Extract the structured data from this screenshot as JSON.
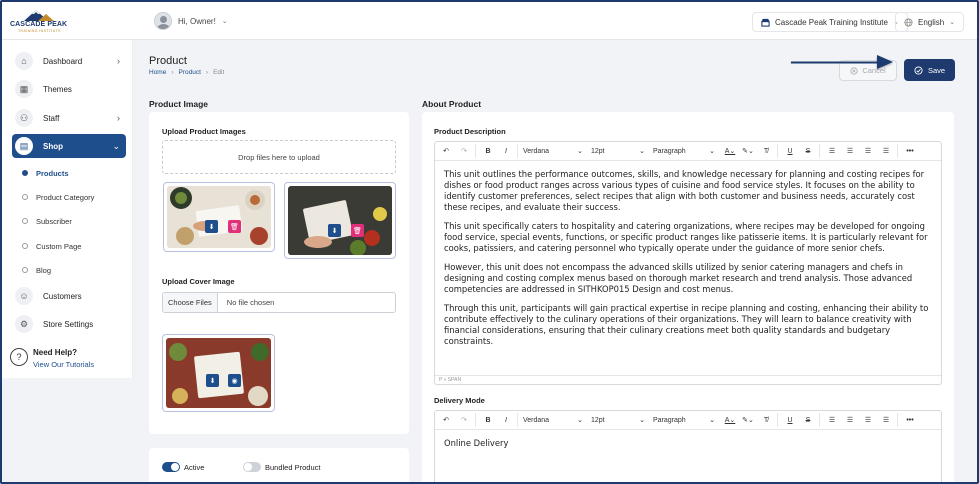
{
  "brand": {
    "name": "CASCADE PEAK",
    "tagline": "TRAINING INSTITUTE"
  },
  "header": {
    "greeting": "Hi, Owner!",
    "institute": "Cascade Peak Training Institute",
    "language": "English"
  },
  "sidebar": {
    "items": [
      {
        "label": "Dashboard",
        "icon": "home-icon"
      },
      {
        "label": "Themes",
        "icon": "themes-icon"
      },
      {
        "label": "Staff",
        "icon": "staff-icon"
      },
      {
        "label": "Shop",
        "icon": "shop-icon"
      },
      {
        "label": "Customers",
        "icon": "customer-icon"
      },
      {
        "label": "Store Settings",
        "icon": "gear-icon"
      }
    ],
    "shop_sub": [
      "Products",
      "Product Category",
      "Subscriber",
      "Custom Page",
      "Blog"
    ],
    "help_title": "Need Help?",
    "help_link": "View Our Tutorials"
  },
  "page": {
    "title": "Product",
    "breadcrumb": [
      "Home",
      "Product",
      "Edit"
    ],
    "cancel_label": "Cancel",
    "save_label": "Save"
  },
  "product_image": {
    "section_title": "Product Image",
    "upload_label": "Upload Product Images",
    "dropzone_text": "Drop files here to upload",
    "cover_label": "Upload Cover Image",
    "choose_files": "Choose Files",
    "no_file": "No file chosen"
  },
  "toggles": {
    "active_label": "Active",
    "bundled_label": "Bundled Product"
  },
  "about": {
    "section_title": "About Product",
    "description_label": "Product Description",
    "delivery_label": "Delivery Mode",
    "toolbar": {
      "font": "Verdana",
      "size": "12pt",
      "block": "Paragraph"
    },
    "status_path": "P » SPAN",
    "description_paragraphs": [
      "This unit outlines the performance outcomes, skills, and knowledge necessary for planning and costing recipes for dishes or food product ranges across various types of cuisine and food service styles. It focuses on the ability to identify customer preferences, select recipes that align with both customer and business needs, accurately cost these recipes, and evaluate their success.",
      "This unit specifically caters to hospitality and catering organizations, where recipes may be developed for ongoing food service, special events, functions, or specific product ranges like patisserie items. It is particularly relevant for cooks, patissiers, and catering personnel who typically operate under the guidance of more senior chefs.",
      "However, this unit does not encompass the advanced skills utilized by senior catering managers and chefs in designing and costing complex menus based on thorough market research and trend analysis. Those advanced competencies are addressed in SITHKOP015 Design and cost menus.",
      "Through this unit, participants will gain practical expertise in recipe planning and costing, enhancing their ability to contribute effectively to the culinary operations of their organizations. They will learn to balance creativity with financial considerations, ensuring that their culinary creations meet both quality standards and budgetary constraints."
    ],
    "delivery_text": "Online Delivery"
  },
  "colors": {
    "primary": "#1f3a6e",
    "accent": "#1f4e8c",
    "pink": "#e0307a"
  }
}
